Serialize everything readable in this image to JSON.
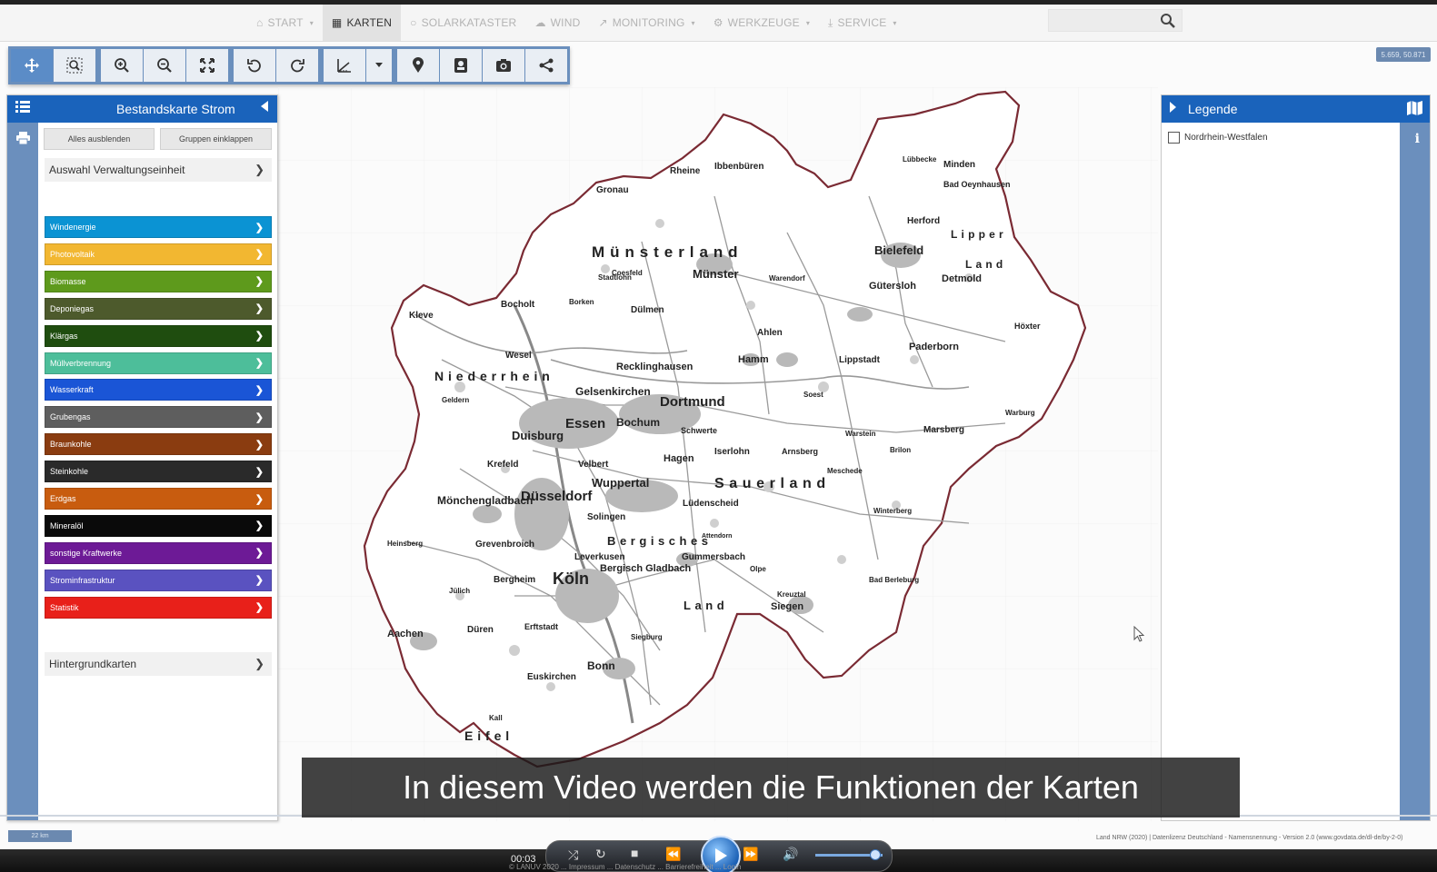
{
  "nav": {
    "items": [
      {
        "label": "START",
        "icon": "home-icon",
        "caret": true
      },
      {
        "label": "KARTEN",
        "icon": "map-icon",
        "caret": false,
        "active": true
      },
      {
        "label": "SOLARKATASTER",
        "icon": "sun-icon",
        "caret": false
      },
      {
        "label": "WIND",
        "icon": "cloud-icon",
        "caret": false
      },
      {
        "label": "MONITORING",
        "icon": "line-chart-icon",
        "caret": true
      },
      {
        "label": "WERKZEUGE",
        "icon": "gears-icon",
        "caret": true
      },
      {
        "label": "SERVICE",
        "icon": "download-icon",
        "caret": true
      }
    ],
    "search_placeholder": ""
  },
  "toolbar": {
    "tools": [
      "pan-icon",
      "zoom-box-icon",
      "zoom-in-icon",
      "zoom-out-icon",
      "full-extent-icon",
      "undo-icon",
      "redo-icon",
      "measure-icon",
      "measure-dropdown-icon",
      "marker-icon",
      "bookmark-icon",
      "camera-icon",
      "share-icon"
    ]
  },
  "coords": "5.659, 50.871",
  "left_panel": {
    "title": "Bestandskarte Strom",
    "btn_hide_all": "Alles ausblenden",
    "btn_collapse_groups": "Gruppen einklappen",
    "admin_unit": "Auswahl Verwaltungseinheit",
    "background_maps": "Hintergrundkarten",
    "layers": [
      {
        "label": "Windenergie",
        "color": "#0b93d3"
      },
      {
        "label": "Photovoltaik",
        "color": "#f2b731"
      },
      {
        "label": "Biomasse",
        "color": "#5e9a1c"
      },
      {
        "label": "Deponiegas",
        "color": "#4d5a2c"
      },
      {
        "label": "Klärgas",
        "color": "#1f4d0f"
      },
      {
        "label": "Müllverbrennung",
        "color": "#4dbe9a"
      },
      {
        "label": "Wasserkraft",
        "color": "#1a55d6"
      },
      {
        "label": "Grubengas",
        "color": "#5e5e5e"
      },
      {
        "label": "Braunkohle",
        "color": "#8a3c10"
      },
      {
        "label": "Steinkohle",
        "color": "#2a2a2a"
      },
      {
        "label": "Erdgas",
        "color": "#c85c0f"
      },
      {
        "label": "Mineralöl",
        "color": "#0a0a0a"
      },
      {
        "label": "sonstige Kraftwerke",
        "color": "#6d1a96"
      },
      {
        "label": "Strominfrastruktur",
        "color": "#5a52c0"
      },
      {
        "label": "Statistik",
        "color": "#e8201a"
      }
    ]
  },
  "legend": {
    "title": "Legende",
    "item": "Nordrhein-Westfalen"
  },
  "map": {
    "labels": [
      {
        "text": "Münsterland",
        "size": 17,
        "spaced": true
      },
      {
        "text": "Münster",
        "size": 13
      },
      {
        "text": "Bielefeld",
        "size": 13
      },
      {
        "text": "Lipper",
        "size": 12,
        "spaced": true
      },
      {
        "text": "Land",
        "size": 12,
        "spaced": true
      },
      {
        "text": "Ibbenbüren",
        "size": 10
      },
      {
        "text": "Rheine",
        "size": 10
      },
      {
        "text": "Gronau",
        "size": 10
      },
      {
        "text": "Minden",
        "size": 10
      },
      {
        "text": "Lübbecke",
        "size": 8
      },
      {
        "text": "Bad Oeynhausen",
        "size": 9
      },
      {
        "text": "Herford",
        "size": 10
      },
      {
        "text": "Detmold",
        "size": 11
      },
      {
        "text": "Gütersloh",
        "size": 11
      },
      {
        "text": "Warendorf",
        "size": 8
      },
      {
        "text": "Coesfeld",
        "size": 8
      },
      {
        "text": "Stadtlohn",
        "size": 8
      },
      {
        "text": "Bocholt",
        "size": 10
      },
      {
        "text": "Borken",
        "size": 8
      },
      {
        "text": "Dülmen",
        "size": 10
      },
      {
        "text": "Ahlen",
        "size": 10
      },
      {
        "text": "Paderborn",
        "size": 11
      },
      {
        "text": "Höxter",
        "size": 9
      },
      {
        "text": "Kleve",
        "size": 10
      },
      {
        "text": "Wesel",
        "size": 10
      },
      {
        "text": "Recklinghausen",
        "size": 11
      },
      {
        "text": "Hamm",
        "size": 11
      },
      {
        "text": "Lippstadt",
        "size": 10
      },
      {
        "text": "Niederrhein",
        "size": 14,
        "spaced": true
      },
      {
        "text": "Geldern",
        "size": 8
      },
      {
        "text": "Gelsenkirchen",
        "size": 12
      },
      {
        "text": "Dortmund",
        "size": 15
      },
      {
        "text": "Essen",
        "size": 15
      },
      {
        "text": "Bochum",
        "size": 12
      },
      {
        "text": "Duisburg",
        "size": 13
      },
      {
        "text": "Soest",
        "size": 8
      },
      {
        "text": "Warburg",
        "size": 8
      },
      {
        "text": "Krefeld",
        "size": 10
      },
      {
        "text": "Velbert",
        "size": 10
      },
      {
        "text": "Schwerte",
        "size": 9
      },
      {
        "text": "Iserlohn",
        "size": 10
      },
      {
        "text": "Hagen",
        "size": 11
      },
      {
        "text": "Arnsberg",
        "size": 9
      },
      {
        "text": "Warstein",
        "size": 8
      },
      {
        "text": "Brilon",
        "size": 8
      },
      {
        "text": "Marsberg",
        "size": 10
      },
      {
        "text": "Wuppertal",
        "size": 13
      },
      {
        "text": "Düsseldorf",
        "size": 15
      },
      {
        "text": "Mönchengladbach",
        "size": 12
      },
      {
        "text": "Sauerland",
        "size": 16,
        "spaced": true
      },
      {
        "text": "Meschede",
        "size": 8
      },
      {
        "text": "Lüdenscheid",
        "size": 10
      },
      {
        "text": "Solingen",
        "size": 10
      },
      {
        "text": "Winterberg",
        "size": 8
      },
      {
        "text": "Heinsberg",
        "size": 8
      },
      {
        "text": "Grevenbroich",
        "size": 10
      },
      {
        "text": "Bergisches",
        "size": 13,
        "spaced": true
      },
      {
        "text": "Leverkusen",
        "size": 10
      },
      {
        "text": "Gummersbach",
        "size": 10
      },
      {
        "text": "Bergisch Gladbach",
        "size": 11
      },
      {
        "text": "Bad Berleburg",
        "size": 8
      },
      {
        "text": "Olpe",
        "size": 8
      },
      {
        "text": "Bergheim",
        "size": 10
      },
      {
        "text": "Köln",
        "size": 18
      },
      {
        "text": "Jülich",
        "size": 8
      },
      {
        "text": "Kreuztal",
        "size": 8
      },
      {
        "text": "Land",
        "size": 13,
        "spaced": true
      },
      {
        "text": "Siegen",
        "size": 11
      },
      {
        "text": "Aachen",
        "size": 11
      },
      {
        "text": "Düren",
        "size": 10
      },
      {
        "text": "Erftstadt",
        "size": 9
      },
      {
        "text": "Siegburg",
        "size": 8
      },
      {
        "text": "Bonn",
        "size": 12
      },
      {
        "text": "Euskirchen",
        "size": 10
      },
      {
        "text": "Eifel",
        "size": 14,
        "spaced": true
      },
      {
        "text": "Kall",
        "size": 8
      },
      {
        "text": "Attendorn",
        "size": 7
      }
    ]
  },
  "scale": "22 km",
  "attribution": "Land NRW (2020) | Datenlizenz Deutschland - Namensnennung - Version 2.0 (www.govdata.de/dl-de/by-2-0)",
  "subtitle": "In diesem Video werden die Funktionen der Karten",
  "video": {
    "time": "00:03",
    "footer": "© LANUV 2020 ... Impressum ... Datenschutz ... Barrierefreiheit ... Login"
  }
}
